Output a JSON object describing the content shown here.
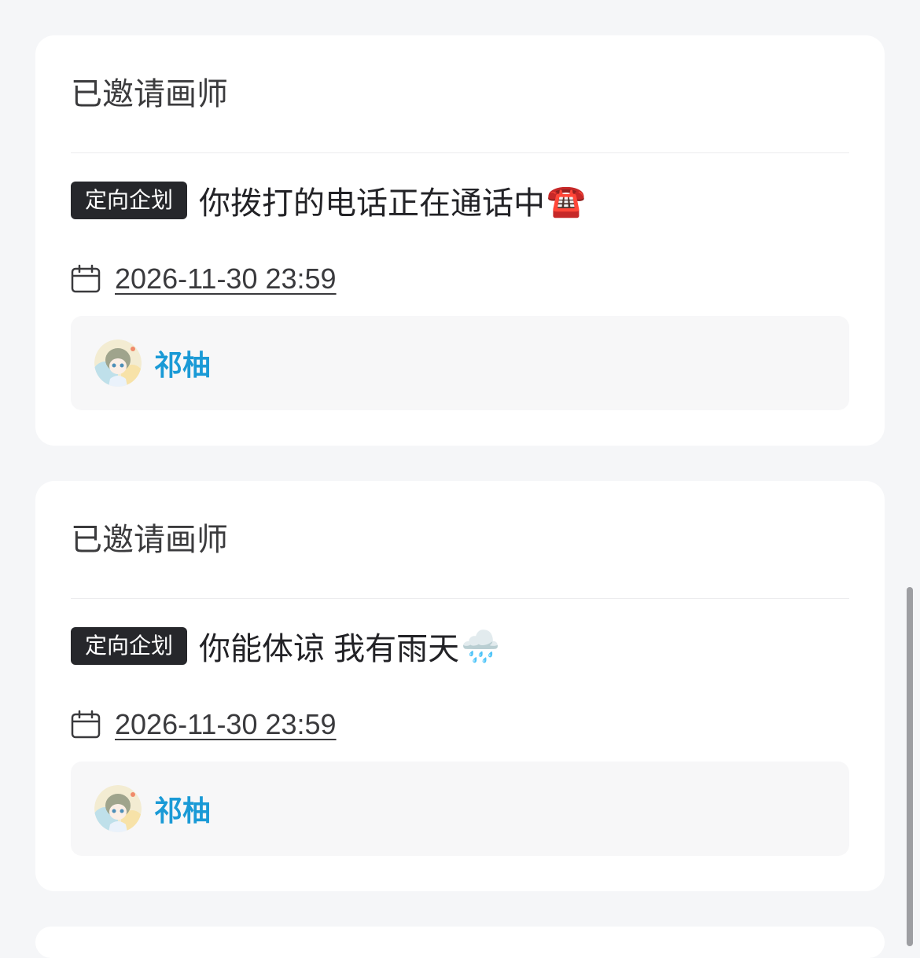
{
  "cards": [
    {
      "heading": "已邀请画师",
      "tag": "定向企划",
      "project_title": "你拨打的电话正在通话中",
      "project_emoji": "☎️",
      "deadline": "2026-11-30 23:59",
      "artist_name": "祁柚"
    },
    {
      "heading": "已邀请画师",
      "tag": "定向企划",
      "project_title": "你能体谅 我有雨天",
      "project_emoji": "🌧️",
      "deadline": "2026-11-30 23:59",
      "artist_name": "祁柚"
    }
  ],
  "colors": {
    "page_bg": "#f5f6f8",
    "card_bg": "#ffffff",
    "tag_bg": "#26272b",
    "artist_name": "#1a9ad6",
    "artist_box_bg": "#f7f7f8"
  },
  "icons": {
    "deadline": "calendar-icon",
    "artist": "avatar"
  }
}
